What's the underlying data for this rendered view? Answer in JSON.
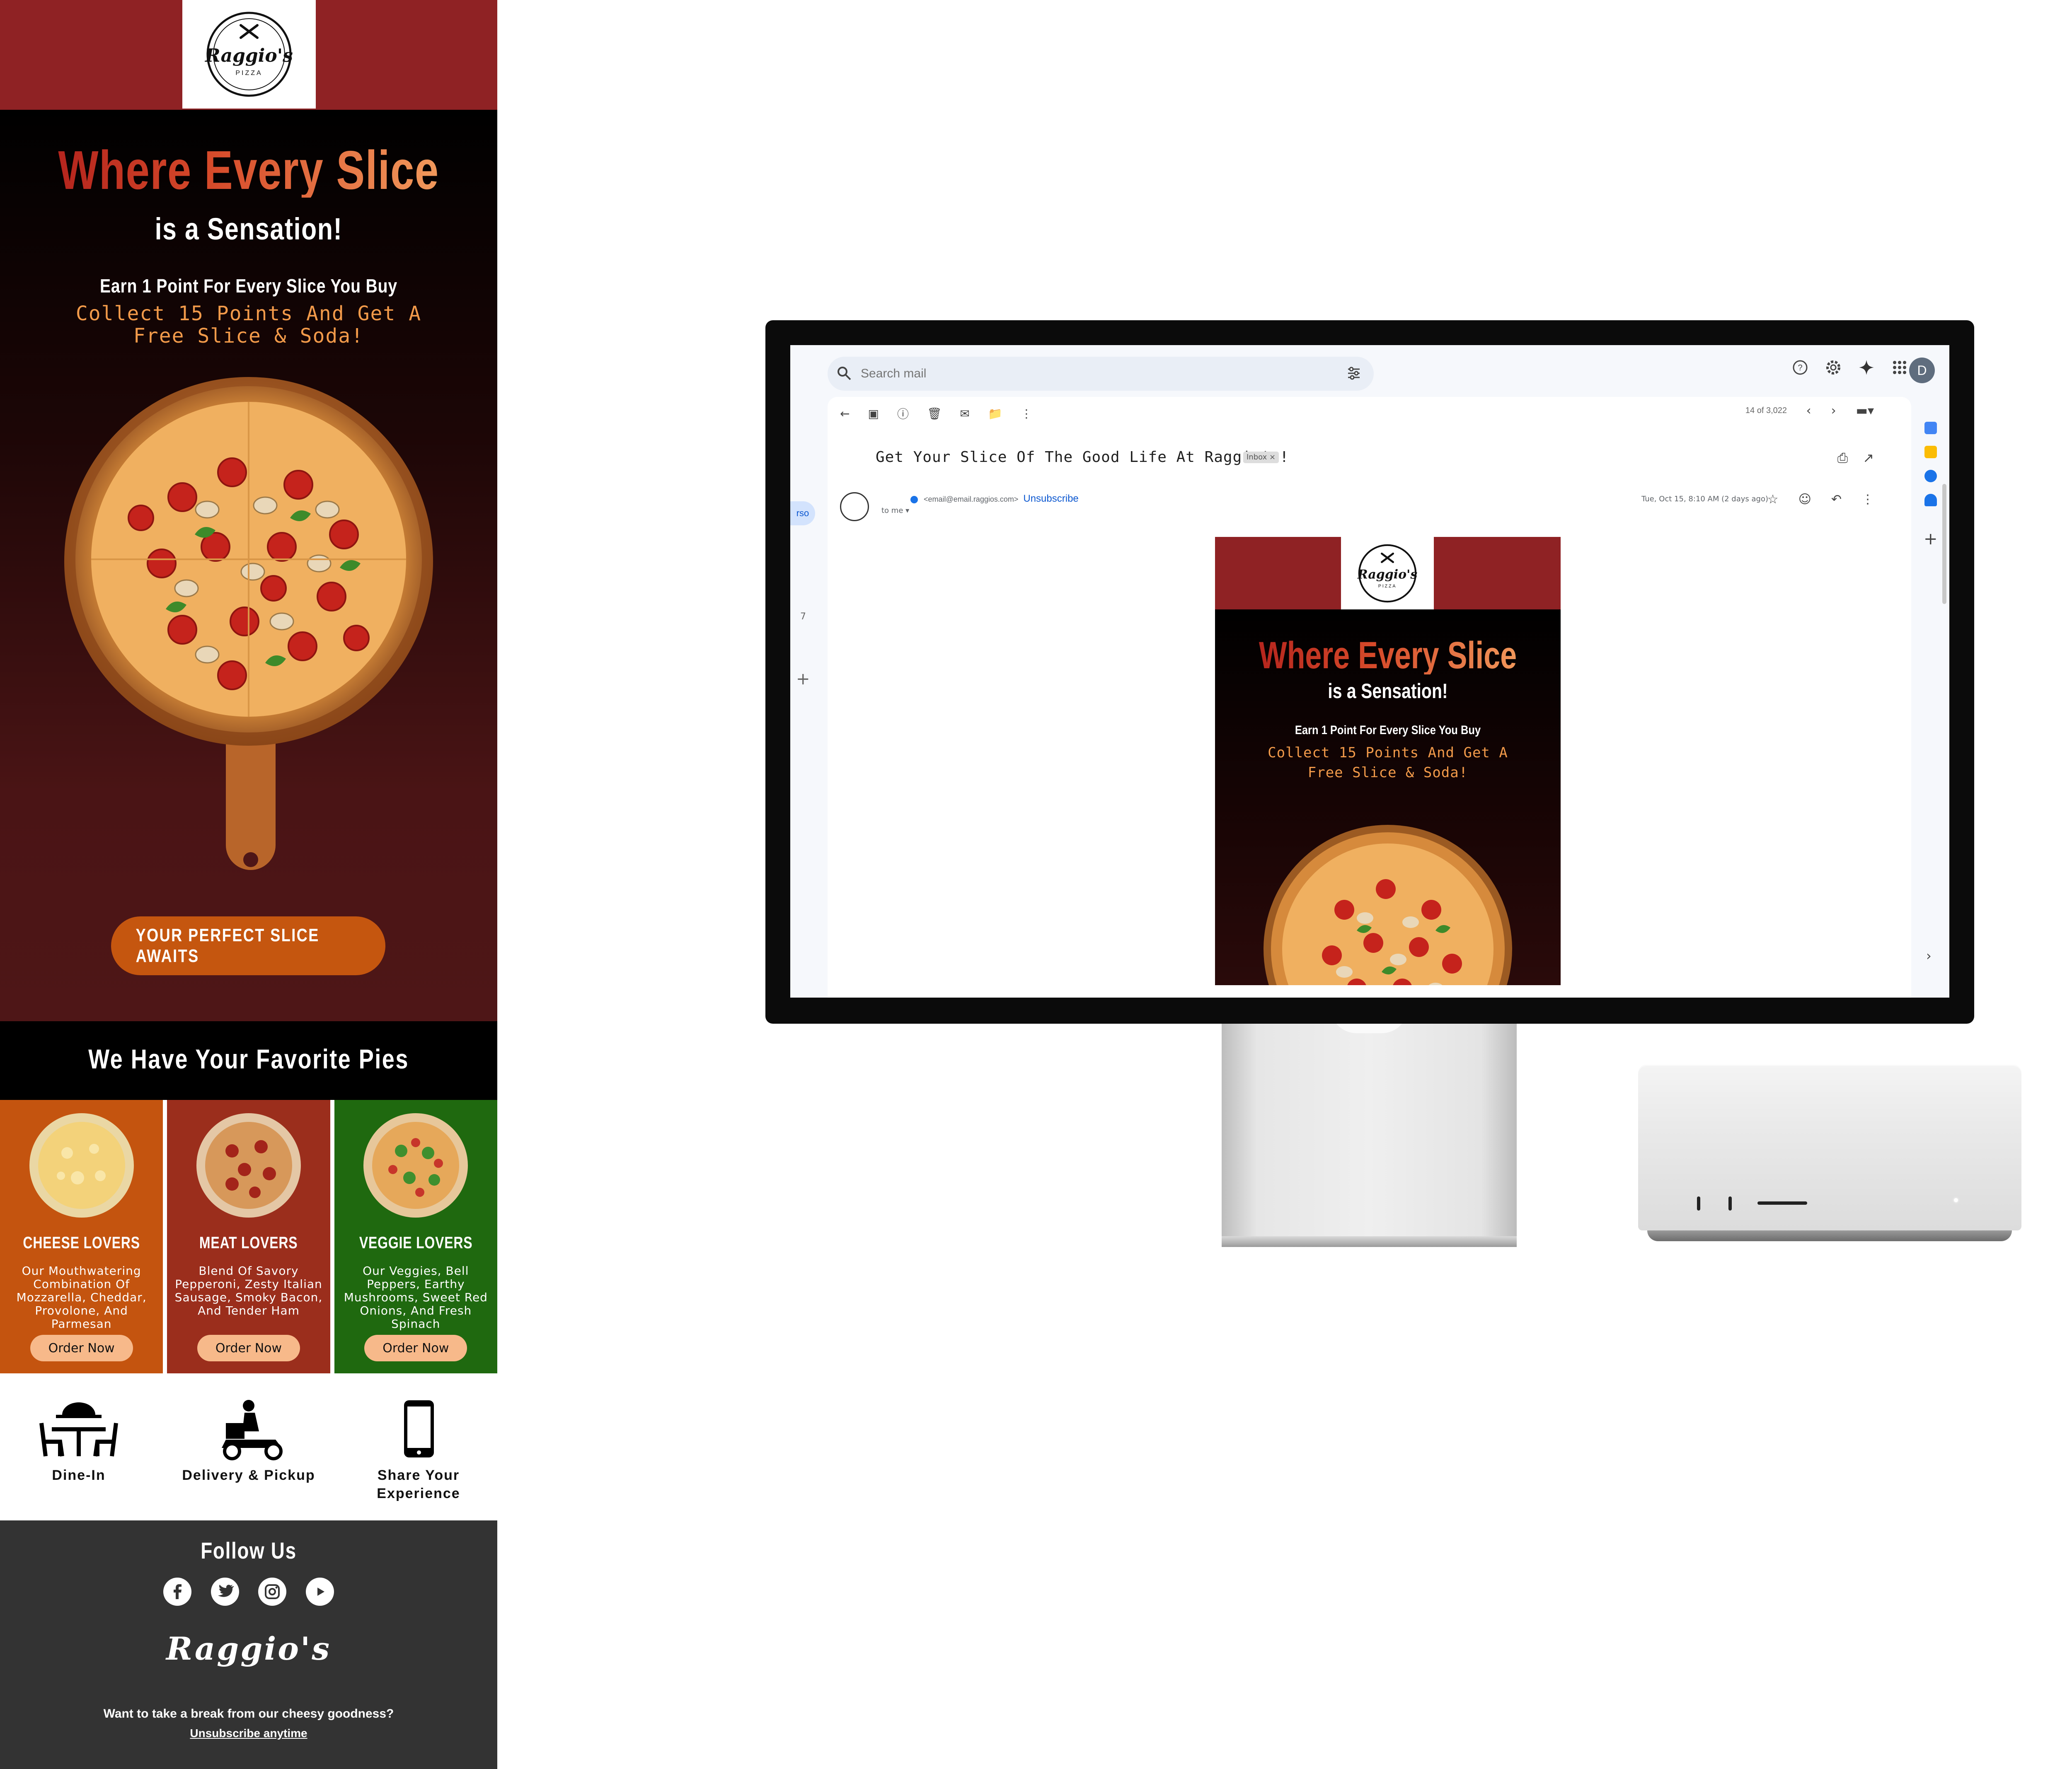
{
  "email": {
    "logo_text": "Raggio's",
    "logo_sub": "PIZZA",
    "headline": "Where Every Slice",
    "subheadline": "is a Sensation!",
    "earn_text": "Earn 1 Point For Every Slice You Buy",
    "collect_text": "Collect 15 Points And Get A Free Slice & Soda!",
    "cta_label": "YOUR PERFECT SLICE AWAITS",
    "favorites_title": "We Have Your Favorite Pies",
    "cards": [
      {
        "title": "CHEESE LOVERS",
        "desc": "Our Mouthwatering Combination Of Mozzarella, Cheddar, Provolone, And Parmesan",
        "button": "Order Now",
        "color": "#c4540f"
      },
      {
        "title": "MEAT LOVERS",
        "desc": "Blend Of Savory Pepperoni, Zesty Italian Sausage, Smoky Bacon, And Tender Ham",
        "button": "Order Now",
        "color": "#9b2e1c"
      },
      {
        "title": "VEGGIE LOVERS",
        "desc": "Our Veggies, Bell Peppers, Earthy Mushrooms, Sweet Red Onions, And Fresh Spinach",
        "button": "Order Now",
        "color": "#1f690f"
      }
    ],
    "services": [
      {
        "icon": "dine-in-icon",
        "label": "Dine-In"
      },
      {
        "icon": "delivery-icon",
        "label": "Delivery & Pickup"
      },
      {
        "icon": "phone-icon",
        "label": "Share Your Experience"
      }
    ],
    "follow_title": "Follow Us",
    "social": [
      "facebook-icon",
      "twitter-icon",
      "instagram-icon",
      "youtube-icon"
    ],
    "brand": "Raggio's",
    "break_text": "Want to take a break from our cheesy goodness?",
    "unsubscribe_text": "Unsubscribe anytime"
  },
  "gmail": {
    "search_placeholder": "Search mail",
    "avatar_letter": "D",
    "count": "14 of 3,022",
    "subject": "Get Your Slice Of The Good Life At Raggio's!",
    "badge": "Inbox ×",
    "sender_email": "<email@email.raggios.com>",
    "unsubscribe": "Unsubscribe",
    "to_me": "to me ▾",
    "date": "Tue, Oct 15, 8:10 AM (2 days ago)",
    "left_pill": "rso",
    "left_num": "7"
  },
  "preview": {
    "headline": "Where Every Slice",
    "subheadline": "is a Sensation!",
    "earn_text": "Earn 1 Point For Every Slice You Buy",
    "collect_text": "Collect 15 Points And Get A Free Slice & Soda!"
  },
  "colors": {
    "brand_red": "#8f2224",
    "cta_orange": "#c5560f",
    "footer_gray": "#333333",
    "gmail_bg": "#f6f8fc"
  }
}
